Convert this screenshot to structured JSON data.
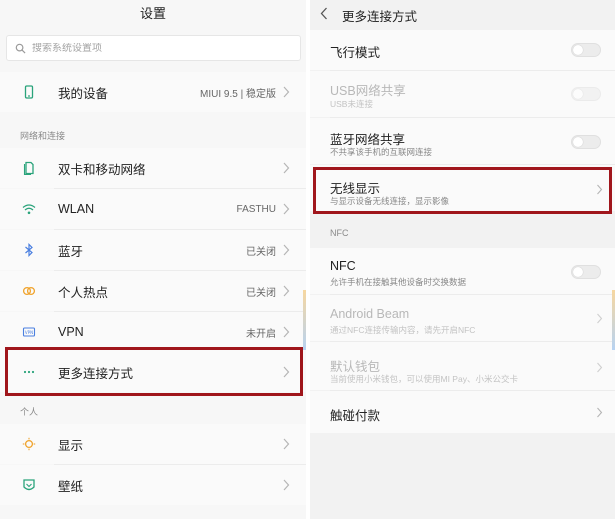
{
  "left": {
    "title": "设置",
    "search_placeholder": "搜索系统设置项",
    "my_device": {
      "label": "我的设备",
      "value": "MIUI 9.5 | 稳定版"
    },
    "section_network": "网络和连接",
    "items": [
      {
        "label": "双卡和移动网络",
        "value": "",
        "icon": "sim-card-icon"
      },
      {
        "label": "WLAN",
        "value": "FASTHU",
        "icon": "wifi-icon"
      },
      {
        "label": "蓝牙",
        "value": "已关闭",
        "icon": "bluetooth-icon"
      },
      {
        "label": "个人热点",
        "value": "已关闭",
        "icon": "hotspot-icon"
      },
      {
        "label": "VPN",
        "value": "未开启",
        "icon": "vpn-icon"
      },
      {
        "label": "更多连接方式",
        "value": "",
        "icon": "more-dots-icon"
      }
    ],
    "section_personal": "个人",
    "personal_items": [
      {
        "label": "显示",
        "icon": "display-icon"
      },
      {
        "label": "壁纸",
        "icon": "wallpaper-icon"
      }
    ]
  },
  "right": {
    "title": "更多连接方式",
    "items": [
      {
        "title": "飞行模式",
        "subtitle": "",
        "control": "toggle",
        "enabled": true
      },
      {
        "title": "USB网络共享",
        "subtitle": "USB未连接",
        "control": "toggle",
        "enabled": false
      },
      {
        "title": "蓝牙网络共享",
        "subtitle": "不共享该手机的互联网连接",
        "control": "toggle",
        "enabled": true
      },
      {
        "title": "无线显示",
        "subtitle": "与显示设备无线连接，显示影像",
        "control": "chevron",
        "enabled": true
      }
    ],
    "section_nfc": "NFC",
    "nfc_items": [
      {
        "title": "NFC",
        "subtitle": "允许手机在接触其他设备时交换数据",
        "control": "toggle",
        "enabled": true
      },
      {
        "title": "Android Beam",
        "subtitle": "通过NFC连接传输内容，请先开启NFC",
        "control": "chevron",
        "enabled": false
      },
      {
        "title": "默认钱包",
        "subtitle": "当前使用小米钱包，可以使用MI Pay、小米公交卡",
        "control": "chevron",
        "enabled": false
      },
      {
        "title": "触碰付款",
        "subtitle": "",
        "control": "chevron",
        "enabled": true
      }
    ]
  },
  "colors": {
    "highlight": "#a0161c",
    "accent_icon": "#2aa37b",
    "bluetooth_icon": "#4a7fe0",
    "hotspot_icon": "#f0a32c"
  }
}
